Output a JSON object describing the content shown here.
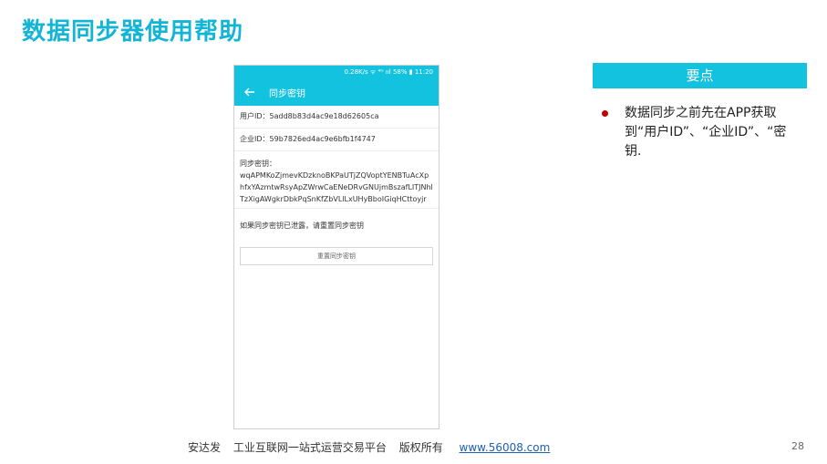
{
  "slide": {
    "title": "数据同步器使用帮助"
  },
  "phone": {
    "status_bar": "0.28K/s ᯤ ⁴ᴳ ııl 58% ▮ 11:20",
    "app_bar": {
      "title": "同步密钥"
    },
    "user_id_line": "用户ID：5add8b83d4ac9e18d62605ca",
    "company_id_line": "企业ID：59b7826ed4ac9e6bfb1f4747",
    "sync_key_label": "同步密钥：",
    "sync_key_value": "wqAPMKoZjmevKDzknoBKPaUTjZQVoptYENBTuAcXphfxYAzmtwRsyApZWrwCaENeDRvGNUjmBszafLITJNhlTzXigAWgkrDbkPqSnKfZbVLlLxUHyBboIGiqHCttoyjr",
    "leak_notice": "如果同步密钥已泄露，请重置同步密钥",
    "reset_button": "重置同步密钥"
  },
  "key_points": {
    "header": "要点",
    "bullet": "数据同步之前先在APP获取到“用户ID”、“企业ID”、“密钥."
  },
  "footer": {
    "company": "安达发",
    "slogan": "工业互联网一站式运营交易平台",
    "rights": "版权所有",
    "url": "www.56008.com"
  },
  "page_number": "28",
  "colors": {
    "accent": "#12c2df",
    "title": "#13b5d6",
    "bullet": "#c00000",
    "link": "#1f5fb4"
  }
}
